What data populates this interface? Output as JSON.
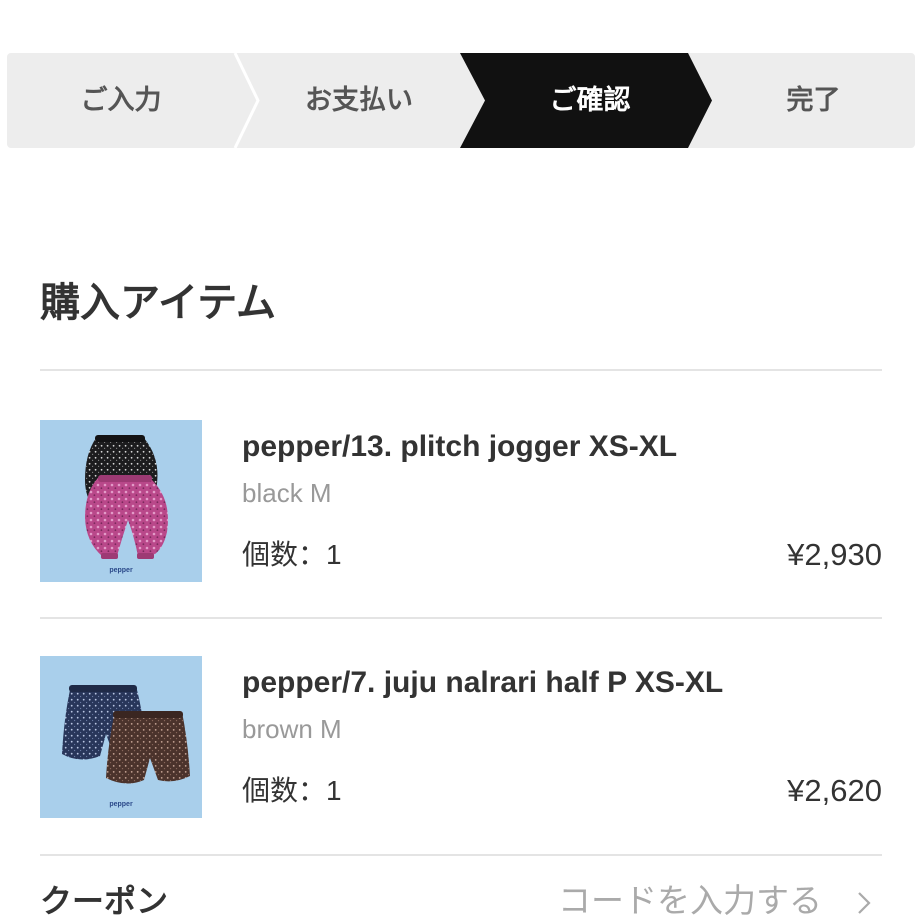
{
  "step_indicator": {
    "active_index": 2,
    "steps": [
      {
        "label": "ご入力"
      },
      {
        "label": "お支払い"
      },
      {
        "label": "ご確認"
      },
      {
        "label": "完了"
      }
    ]
  },
  "purchase_items": {
    "title": "購入アイテム",
    "items": [
      {
        "name": "pepper/13. plitch jogger XS-XL",
        "variant": "black M",
        "quantity_label": "個数：",
        "quantity": "1",
        "price": "¥2,930",
        "thumbnail_logo": "pepper"
      },
      {
        "name": "pepper/7. juju nalrari half P XS-XL",
        "variant": "brown M",
        "quantity_label": "個数：",
        "quantity": "1",
        "price": "¥2,620",
        "thumbnail_logo": "pepper"
      }
    ]
  },
  "coupon": {
    "label": "クーポン",
    "placeholder": "コードを入力する",
    "icon": "chevron-right-icon"
  },
  "colors": {
    "step_bar_background": "#ededed",
    "active_step_background": "#111111",
    "active_step_text": "#ffffff",
    "text_primary": "#333333",
    "text_muted": "#999999",
    "thumbnail_background": "#a9cfeb"
  }
}
